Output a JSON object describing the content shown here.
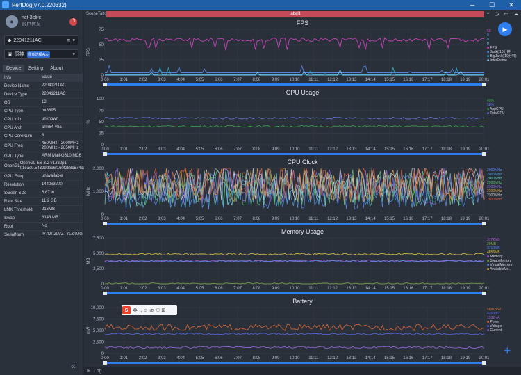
{
  "window": {
    "title": "PerfDog(v7.0.220332)"
  },
  "user": {
    "name": "net 3elife",
    "sub": "账户信息"
  },
  "device_select": "22041211AC",
  "app_select": {
    "name": "原神",
    "badge": "重新选择App"
  },
  "tabs": [
    "Device",
    "Setting",
    "About"
  ],
  "info_table": {
    "headers": [
      "Info",
      "Value"
    ],
    "rows": [
      [
        "Device Name",
        "22041211AC"
      ],
      [
        "Device Type",
        "22041211AC"
      ],
      [
        "OS",
        "12"
      ],
      [
        "CPU Type",
        "mt6895"
      ],
      [
        "CPU Info",
        "unknown"
      ],
      [
        "CPU Arch",
        "arm64-v8a"
      ],
      [
        "CPU CoreNum",
        "8"
      ],
      [
        "CPU Freq",
        "450MHz - 2000MHz 200MHz - 2850MHz"
      ],
      [
        "GPU Type",
        "ARM Mali-G610 MC6"
      ],
      [
        "OpenGL",
        "OpenGL ES 3.2 v1.r32p1-01eac0.54329dbe6f160f288c574caaf67bbe3f"
      ],
      [
        "GPU Freq",
        "unavailable"
      ],
      [
        "Resolution",
        "1440x3200"
      ],
      [
        "Screen Size",
        "6.67 in"
      ],
      [
        "Ram Size",
        "11.2 GB"
      ],
      [
        "LMK Threshold",
        "216MB"
      ],
      [
        "Swap",
        "6143 MB"
      ],
      [
        "Root",
        "No"
      ],
      [
        "SerialNum",
        "IV7DPZLVZTYLZTUG"
      ]
    ]
  },
  "scene": {
    "label": "SceneTab:",
    "strip": "label1"
  },
  "time_ticks": [
    "0:00",
    "1:01",
    "2:02",
    "3:03",
    "4:04",
    "5:05",
    "6:06",
    "7:07",
    "8:08",
    "9:09",
    "10:10",
    "11:11",
    "12:12",
    "13:13",
    "14:14",
    "15:15",
    "16:16",
    "17:17",
    "18:18",
    "19:19",
    "20:01"
  ],
  "log_label": "Log",
  "ime": {
    "text": "英 ·, ☺ 画 ⚇ ⊞"
  },
  "colors": {
    "fps": "#d946c7",
    "jank": "#5a8df0",
    "cpu_app": "#6a7be8",
    "cpu_total": "#3ea64a",
    "battery": "#e06a3a"
  },
  "chart_data": [
    {
      "type": "line",
      "title": "FPS",
      "ylabel": "FPS",
      "yticks": [
        "75",
        "50",
        "25",
        "0"
      ],
      "ylim": [
        0,
        75
      ],
      "series": [
        {
          "name": "FPS",
          "value": "59",
          "color": "#d946c7",
          "avg": 58
        },
        {
          "name": "Jank(/10分钟)",
          "value": "0",
          "color": "#5a8df0",
          "avg": 4
        },
        {
          "name": "BigJank(/10分钟)",
          "value": "0",
          "color": "#2ab3c9",
          "avg": 1
        },
        {
          "name": "InterFrame",
          "value": "0",
          "color": "#7fd3ff",
          "avg": 0
        }
      ]
    },
    {
      "type": "line",
      "title": "CPU Usage",
      "ylabel": "%",
      "yticks": [
        "100",
        "75",
        "50",
        "25",
        "0"
      ],
      "ylim": [
        0,
        100
      ],
      "series": [
        {
          "name": "AppCPU",
          "value": "40%",
          "color": "#3ea64a",
          "avg": 40
        },
        {
          "name": "TotalCPU",
          "value": "58%",
          "color": "#6a7be8",
          "avg": 58
        }
      ]
    },
    {
      "type": "line",
      "title": "CPU Clock",
      "ylabel": "MHz",
      "yticks": [
        "2,000",
        "1,000",
        "0"
      ],
      "ylim": [
        0,
        2800
      ],
      "series": [
        {
          "name": "",
          "value": "2000MHz",
          "color": "#5a8df0"
        },
        {
          "name": "",
          "value": "2000MHz",
          "color": "#4aa0d8"
        },
        {
          "name": "",
          "value": "2000MHz",
          "color": "#6fd0c0"
        },
        {
          "name": "",
          "value": "2000MHz",
          "color": "#5ec27a"
        },
        {
          "name": "",
          "value": "2300MHz",
          "color": "#8f6ee0"
        },
        {
          "name": "",
          "value": "2300MHz",
          "color": "#d9a13e"
        },
        {
          "name": "",
          "value": "2300MHz",
          "color": "#c8c8c8"
        },
        {
          "name": "",
          "value": "2600MHz",
          "color": "#e0604a"
        }
      ]
    },
    {
      "type": "line",
      "title": "Memory Usage",
      "ylabel": "MB",
      "yticks": [
        "7,500",
        "5,000",
        "2,500",
        "0"
      ],
      "ylim": [
        0,
        7500
      ],
      "series": [
        {
          "name": "Memory",
          "value": "3772MB",
          "color": "#b05ad8",
          "avg": 3772
        },
        {
          "name": "SwapMemory",
          "value": "20MB",
          "color": "#7aa84a",
          "avg": 20
        },
        {
          "name": "VirtualMemory",
          "value": "3710MB",
          "color": "#5a8df0",
          "avg": 3710
        },
        {
          "name": "AvailableMe...",
          "value": "4856MB",
          "color": "#e0c24a",
          "avg": 4856
        }
      ]
    },
    {
      "type": "line",
      "title": "Battery",
      "ylabel": "mW",
      "yticks": [
        "10,000",
        "7,500",
        "5,000",
        "2,500",
        "0"
      ],
      "ylim": [
        0,
        10000
      ],
      "series": [
        {
          "name": "Power",
          "value": "5681mW",
          "color": "#e06a3a",
          "avg": 5681
        },
        {
          "name": "Voltage",
          "value": "4263mV",
          "color": "#5a6cf0",
          "avg": 4263
        },
        {
          "name": "Current",
          "value": "1332mA",
          "color": "#9a6adf",
          "avg": 1332
        }
      ]
    }
  ]
}
